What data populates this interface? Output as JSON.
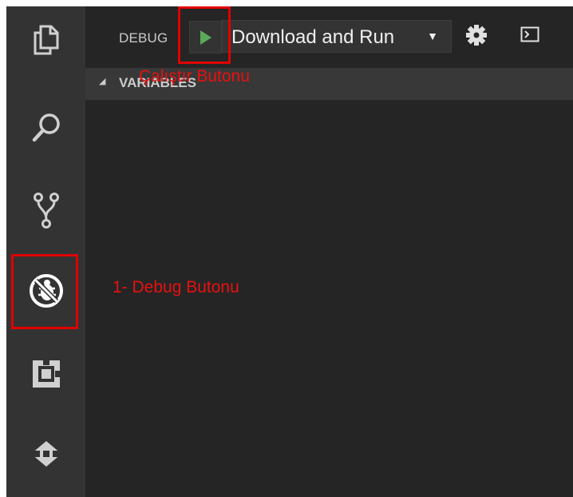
{
  "activity_bar": {
    "items": [
      {
        "name": "explorer-icon"
      },
      {
        "name": "search-icon"
      },
      {
        "name": "git-icon"
      },
      {
        "name": "debug-icon"
      },
      {
        "name": "extensions-icon"
      },
      {
        "name": "remote-icon"
      }
    ]
  },
  "toolbar": {
    "debug_label": "DEBUG",
    "play_icon": "play-icon",
    "config_value": "Download and Run",
    "config_arrow": "▼",
    "gear_icon": "gear-icon",
    "terminal_icon": "terminal-icon"
  },
  "variables": {
    "twistie": "◢",
    "title": "VARIABLES"
  },
  "annotations": {
    "run_button": "Çalıştır Butonu",
    "debug_button": "1- Debug Butonu",
    "color": "#e8110f"
  },
  "colors": {
    "activity_bar": "#333333",
    "sidebar": "#252526",
    "play_green": "#5aa95a",
    "highlight_red": "#e00000"
  }
}
